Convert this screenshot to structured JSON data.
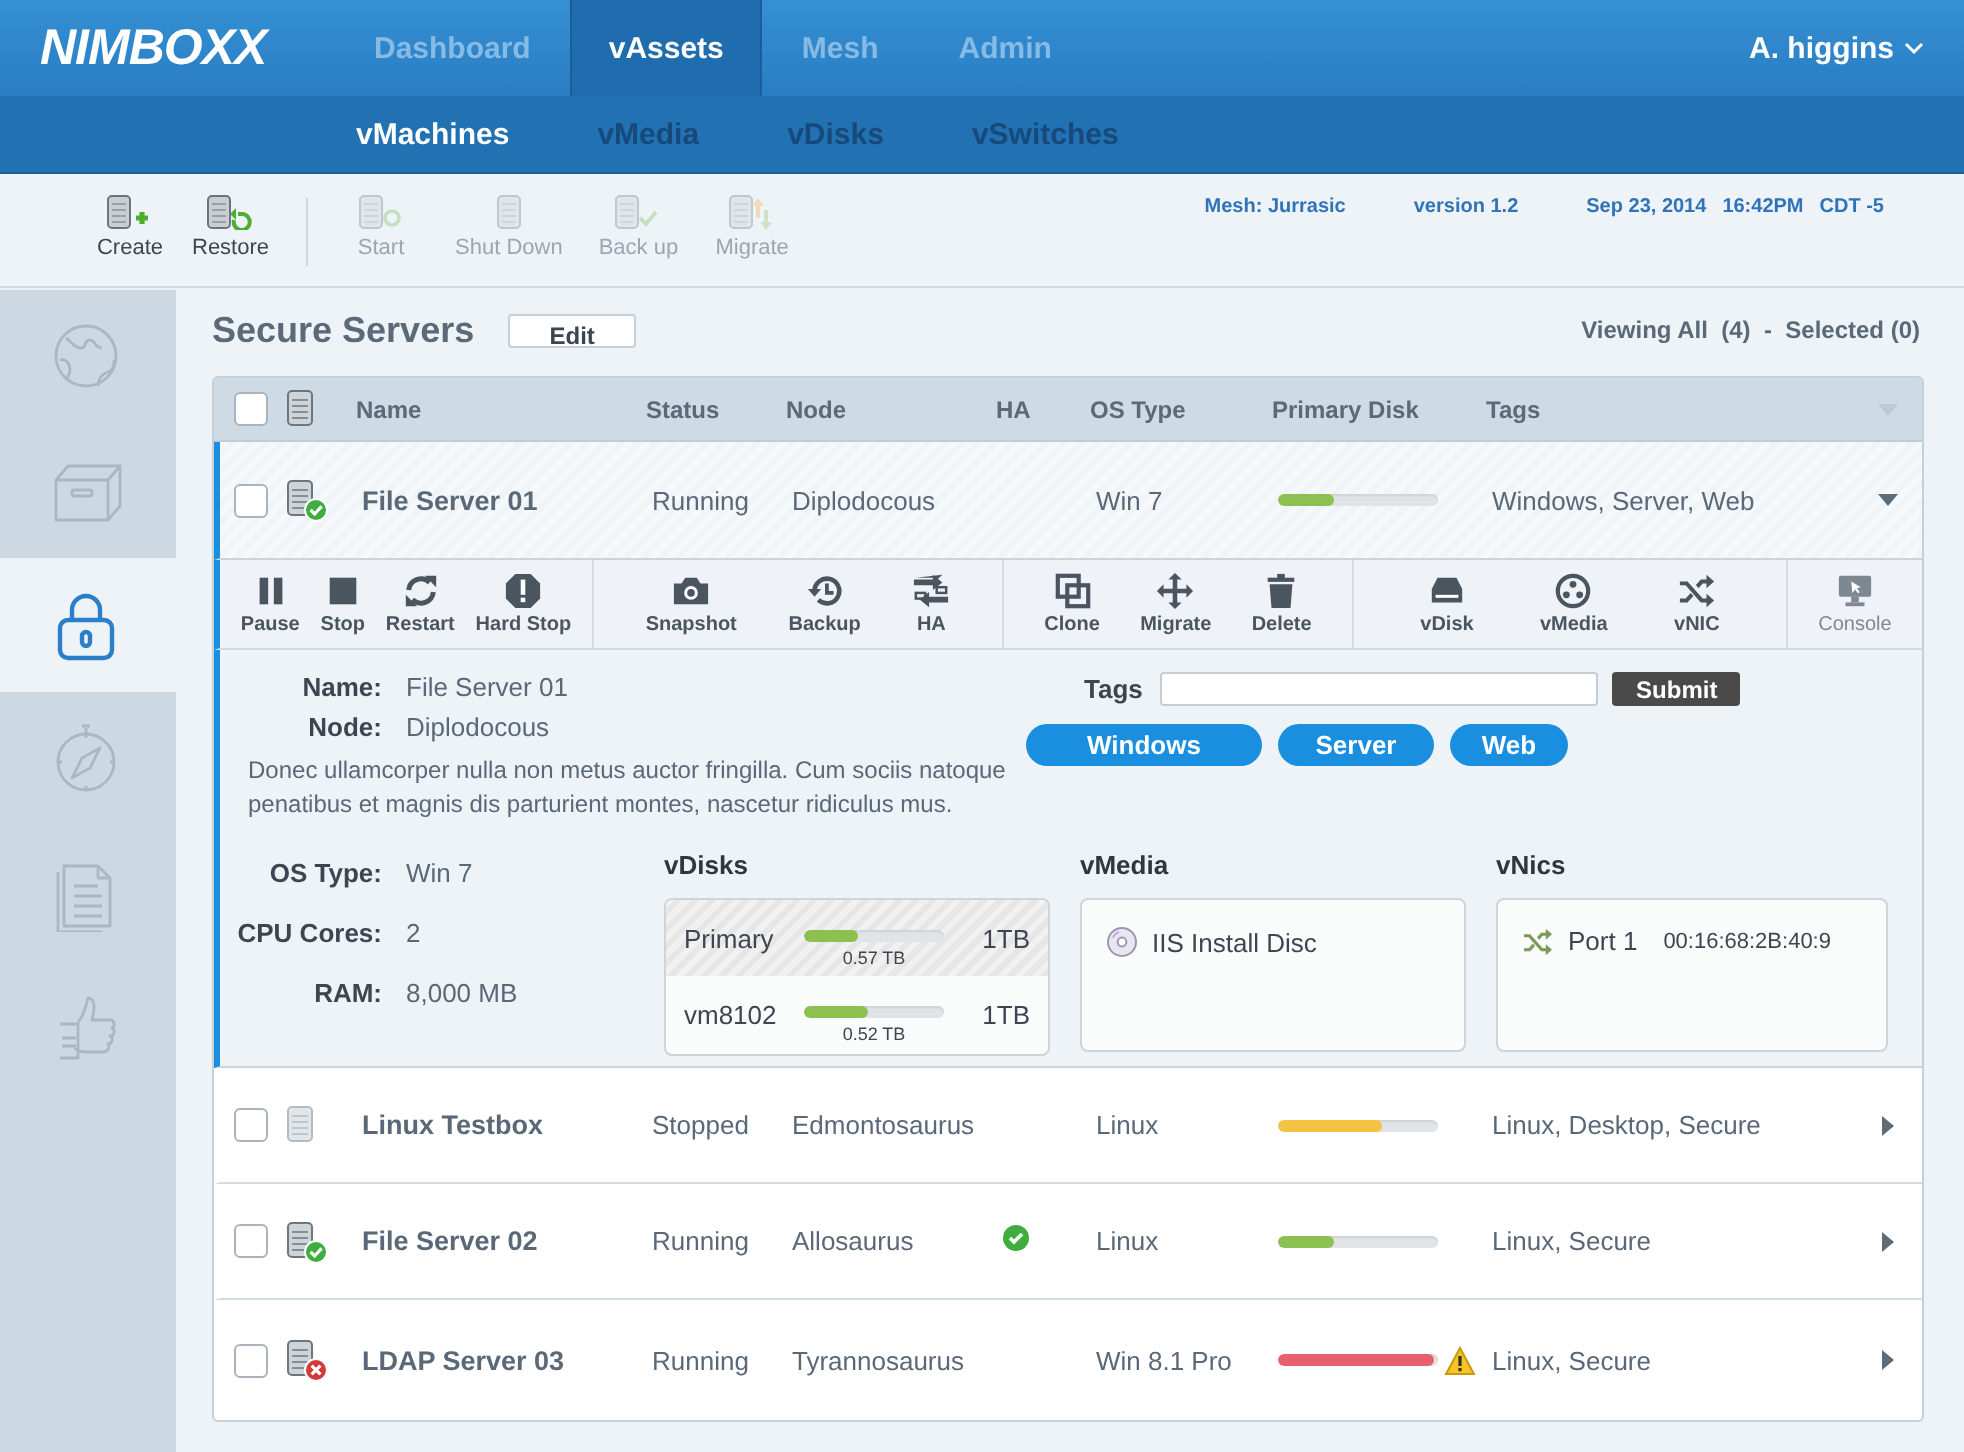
{
  "header": {
    "logo": "NIMBOXX",
    "tabs": [
      {
        "label": "Dashboard",
        "selected": false
      },
      {
        "label": "vAssets",
        "selected": true
      },
      {
        "label": "Mesh",
        "selected": false
      },
      {
        "label": "Admin",
        "selected": false
      }
    ],
    "user": "A. higgins"
  },
  "subtabs": [
    {
      "label": "vMachines",
      "selected": true
    },
    {
      "label": "vMedia",
      "selected": false
    },
    {
      "label": "vDisks",
      "selected": false
    },
    {
      "label": "vSwitches",
      "selected": false
    }
  ],
  "toolbar": {
    "actions": [
      {
        "kind": "create",
        "label": "Create",
        "disabled": false
      },
      {
        "kind": "restore",
        "label": "Restore",
        "disabled": false
      },
      {
        "kind": "start",
        "label": "Start",
        "disabled": true
      },
      {
        "kind": "shutdown",
        "label": "Shut Down",
        "disabled": true
      },
      {
        "kind": "backup",
        "label": "Back up",
        "disabled": true
      },
      {
        "kind": "migrate",
        "label": "Migrate",
        "disabled": true
      }
    ],
    "mesh": "Mesh: Jurrasic",
    "version": "version 1.2",
    "date": "Sep 23, 2014",
    "time": "16:42PM",
    "timezone": "CDT -5"
  },
  "sidebar": [
    {
      "kind": "globe",
      "selected": false
    },
    {
      "kind": "box",
      "selected": false
    },
    {
      "kind": "lock",
      "selected": true
    },
    {
      "kind": "compass",
      "selected": false
    },
    {
      "kind": "document",
      "selected": false
    },
    {
      "kind": "thumbs-up",
      "selected": false
    }
  ],
  "panel": {
    "title": "Secure Servers",
    "edit": "Edit",
    "viewing": "Viewing All  (4)  -  Selected (0)"
  },
  "table": {
    "select_all": false,
    "columns": [
      "Name",
      "Status",
      "Node",
      "HA",
      "OS Type",
      "Primary Disk",
      "Tags"
    ],
    "rows": [
      {
        "checked": false,
        "kind": "ok",
        "name": "File Server 01",
        "status": "Running",
        "node": "Diplodocous",
        "ha": false,
        "os": "Win 7",
        "disk": {
          "level": 0.35,
          "color": "#8cc152",
          "warning": false
        },
        "tags": "Windows, Server, Web",
        "expanded": true
      },
      {
        "checked": false,
        "kind": "off",
        "name": "Linux Testbox",
        "status": "Stopped",
        "node": "Edmontosaurus",
        "ha": false,
        "os": "Linux",
        "disk": {
          "level": 0.65,
          "color": "#f5c342",
          "warning": false
        },
        "tags": "Linux, Desktop, Secure",
        "expanded": false
      },
      {
        "checked": false,
        "kind": "ok",
        "name": "File Server 02",
        "status": "Running",
        "node": "Allosaurus",
        "ha": true,
        "os": "Linux",
        "disk": {
          "level": 0.35,
          "color": "#8cc152",
          "warning": false
        },
        "tags": "Linux, Secure",
        "expanded": false
      },
      {
        "checked": false,
        "kind": "error",
        "name": "LDAP Server 03",
        "status": "Running",
        "node": "Tyrannosaurus",
        "ha": false,
        "os": "Win 8.1 Pro",
        "disk": {
          "level": 0.97,
          "color": "#e8606e",
          "warning": true
        },
        "tags": "Linux, Secure",
        "expanded": false
      }
    ]
  },
  "details": {
    "action_groups": [
      {
        "actions": [
          {
            "kind": "pause",
            "label": "Pause",
            "disabled": false
          },
          {
            "kind": "stop",
            "label": "Stop",
            "disabled": false
          },
          {
            "kind": "restart",
            "label": "Restart",
            "disabled": false
          },
          {
            "kind": "hardstop",
            "label": "Hard Stop",
            "disabled": false
          }
        ]
      },
      {
        "actions": [
          {
            "kind": "snapshot",
            "label": "Snapshot",
            "disabled": false
          },
          {
            "kind": "backup",
            "label": "Backup",
            "disabled": false
          },
          {
            "kind": "ha",
            "label": "HA",
            "disabled": false
          }
        ]
      },
      {
        "actions": [
          {
            "kind": "clone",
            "label": "Clone",
            "disabled": false
          },
          {
            "kind": "migrate",
            "label": "Migrate",
            "disabled": false
          },
          {
            "kind": "delete",
            "label": "Delete",
            "disabled": false
          }
        ]
      },
      {
        "actions": [
          {
            "kind": "vdisk",
            "label": "vDisk",
            "disabled": false
          },
          {
            "kind": "vmedia",
            "label": "vMedia",
            "disabled": false
          },
          {
            "kind": "vnic",
            "label": "vNIC",
            "disabled": false
          }
        ]
      },
      {
        "actions": [
          {
            "kind": "console",
            "label": "Console",
            "disabled": true
          }
        ]
      }
    ],
    "info": [
      {
        "label": "Name:",
        "value": "File Server 01"
      },
      {
        "label": "Node:",
        "value": "Diplodocous"
      }
    ],
    "description": "Donec ullamcorper nulla non metus auctor fringilla. Cum sociis natoque penatibus et magnis dis parturient montes, nascetur ridiculus mus.",
    "specs": [
      {
        "label": "OS Type:",
        "value": "Win 7"
      },
      {
        "label": "CPU Cores:",
        "value": "2"
      },
      {
        "label": "RAM:",
        "value": "8,000 MB"
      }
    ],
    "tags_label": "Tags",
    "submit": "Submit",
    "tags": [
      "Windows",
      "Server",
      "Web"
    ],
    "vdisks": {
      "title": "vDisks",
      "items": [
        {
          "name": "Primary",
          "level": 0.38,
          "used": "0.57 TB",
          "size": "1TB",
          "selected": true
        },
        {
          "name": "vm8102",
          "level": 0.45,
          "used": "0.52 TB",
          "size": "1TB",
          "selected": false
        }
      ]
    },
    "vmedia": {
      "title": "vMedia",
      "items": [
        {
          "name": "IIS Install Disc"
        }
      ]
    },
    "vnics": {
      "title": "vNics",
      "items": [
        {
          "name": "Port 1",
          "mac": "00:16:68:2B:40:9"
        }
      ]
    }
  }
}
